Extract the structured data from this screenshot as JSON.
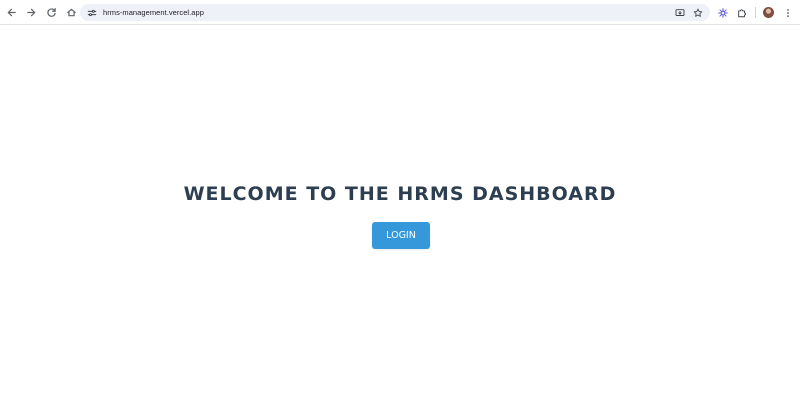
{
  "browser": {
    "url": "hrms-management.vercel.app",
    "icons": {
      "back": "arrow-left-icon",
      "forward": "arrow-right-icon",
      "reload": "reload-icon",
      "home": "home-icon",
      "site_info": "tune-icon",
      "install": "install-app-icon",
      "bookmark": "star-icon",
      "extension": "gear-extension-icon",
      "extensions": "puzzle-icon",
      "profile": "avatar",
      "menu": "more-vertical-icon"
    }
  },
  "main": {
    "headline": "WELCOME TO THE HRMS DASHBOARD",
    "login_label": "LOGIN"
  },
  "colors": {
    "headline": "#2c3e50",
    "button": "#3498db",
    "button_text": "#ffffff"
  }
}
